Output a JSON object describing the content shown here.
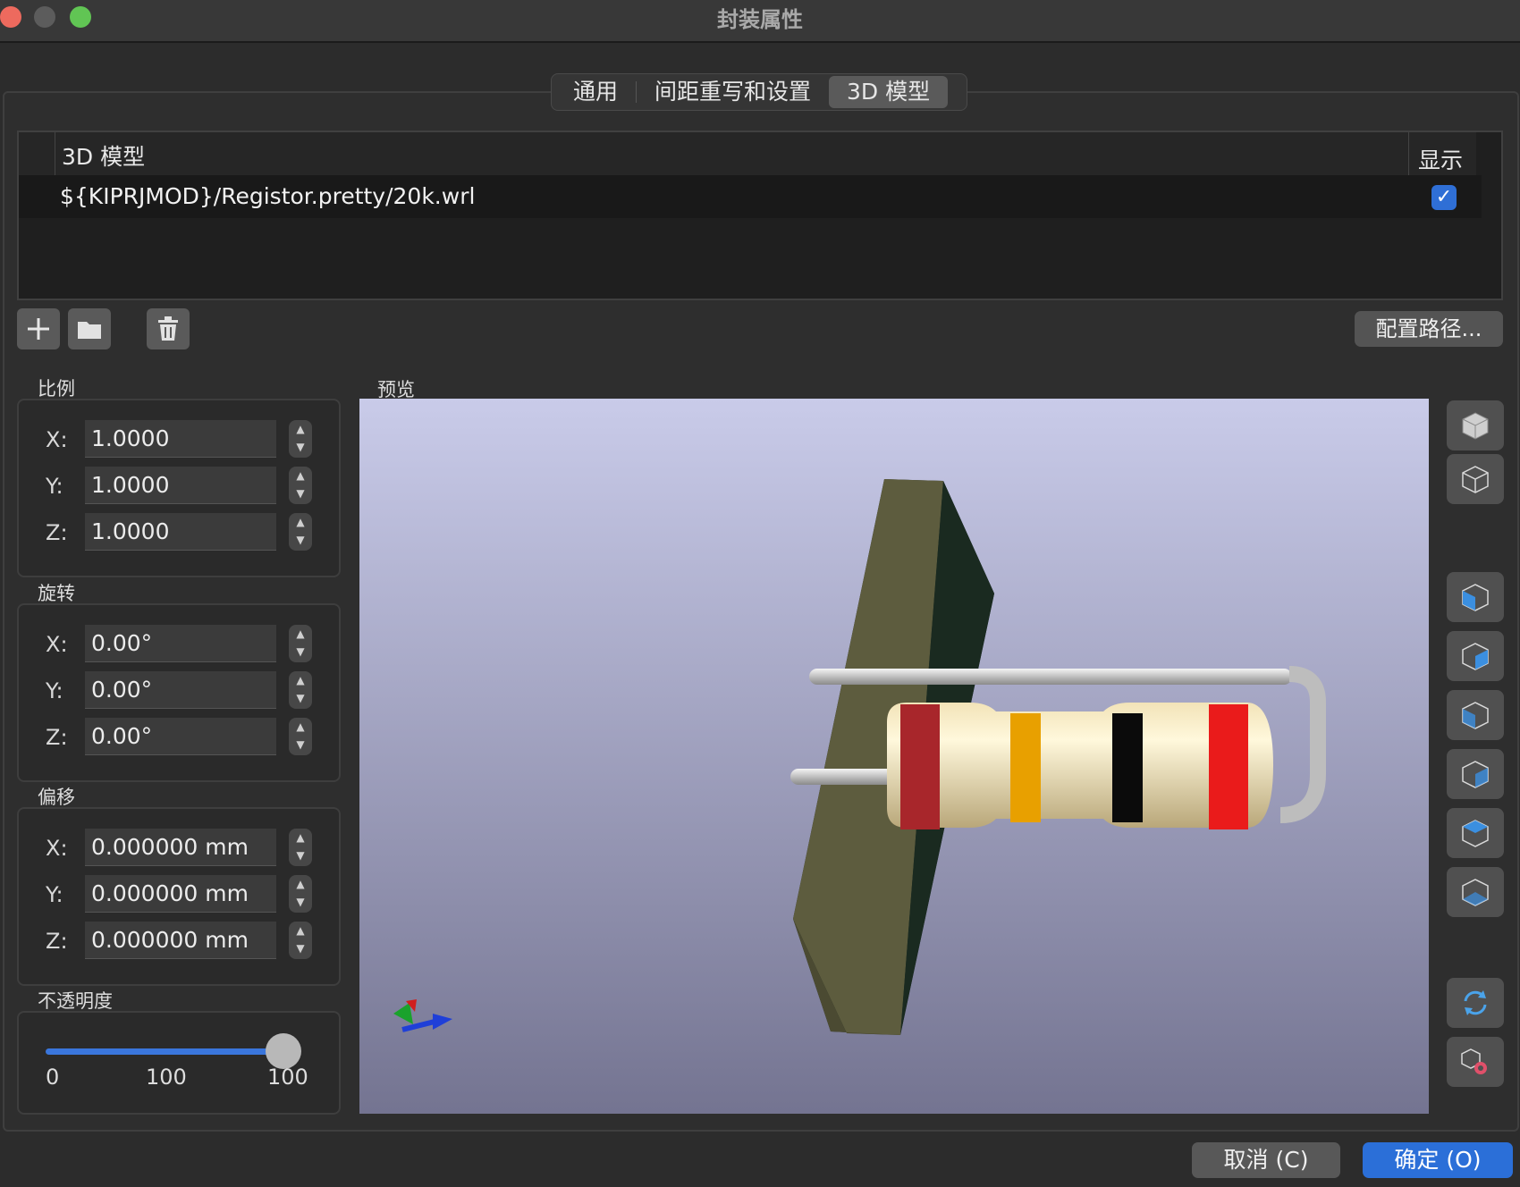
{
  "window": {
    "title": "封装属性"
  },
  "tabs": [
    {
      "label": "通用",
      "active": false
    },
    {
      "label": "间距重写和设置",
      "active": false
    },
    {
      "label": "3D 模型",
      "active": true
    }
  ],
  "model_table": {
    "header": {
      "model": "3D 模型",
      "show": "显示"
    },
    "rows": [
      {
        "path": "${KIPRJMOD}/Registor.pretty/20k.wrl",
        "show": true
      }
    ]
  },
  "toolbar": {
    "add": "add-icon",
    "browse": "folder-icon",
    "delete": "trash-icon",
    "configure_paths": "配置路径..."
  },
  "scale": {
    "title": "比例",
    "x_label": "X:",
    "x": "1.0000",
    "y_label": "Y:",
    "y": "1.0000",
    "z_label": "Z:",
    "z": "1.0000"
  },
  "rotation": {
    "title": "旋转",
    "x_label": "X:",
    "x": "0.00°",
    "y_label": "Y:",
    "y": "0.00°",
    "z_label": "Z:",
    "z": "0.00°"
  },
  "offset": {
    "title": "偏移",
    "x_label": "X:",
    "x": "0.000000 mm",
    "y_label": "Y:",
    "y": "0.000000 mm",
    "z_label": "Z:",
    "z": "0.000000 mm"
  },
  "opacity": {
    "title": "不透明度",
    "min_label": "0",
    "value_label": "100",
    "max_label": "100",
    "value": 100
  },
  "preview": {
    "title": "预览"
  },
  "view_buttons": [
    "view-isometric-icon",
    "view-wireframe-icon",
    "view-left-icon",
    "view-right-icon",
    "view-front-icon",
    "view-back-icon",
    "view-top-icon",
    "view-bottom-icon",
    "reload-icon",
    "render-settings-icon"
  ],
  "footer": {
    "cancel": "取消 (C)",
    "ok": "确定 (O)"
  },
  "colors": {
    "accent": "#2b6fd8",
    "checkbox": "#2f6fd6",
    "window_bg": "#2c2c2c",
    "preview_top": "#c9cbe9",
    "preview_bottom": "#747491"
  }
}
